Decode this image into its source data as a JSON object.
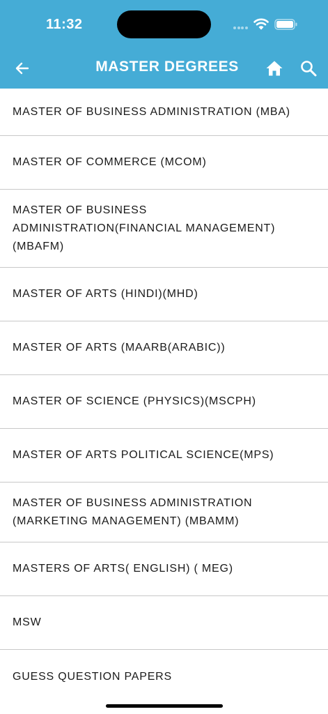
{
  "status_bar": {
    "time": "11:32"
  },
  "colors": {
    "header_background": "#45acd6",
    "header_foreground": "#ffffff",
    "list_text": "#1a1a1a",
    "divider": "#c8c8c8"
  },
  "toolbar": {
    "title": "MASTER DEGREES",
    "back_icon": "arrow-left-icon",
    "home_icon": "home-icon",
    "search_icon": "search-icon"
  },
  "degrees": [
    "MASTER OF BUSINESS ADMINISTRATION (MBA)",
    "MASTER OF COMMERCE (MCOM)",
    "MASTER OF BUSINESS ADMINISTRATION(FINANCIAL MANAGEMENT) (MBAFM)",
    "MASTER OF ARTS (HINDI)(MHD)",
    "MASTER OF ARTS (MAARB(ARABIC))",
    "MASTER OF SCIENCE (PHYSICS)(MSCPH)",
    "MASTER OF ARTS POLITICAL SCIENCE(MPS)",
    "MASTER OF BUSINESS ADMINISTRATION (MARKETING MANAGEMENT) (MBAMM)",
    "MASTERS OF ARTS( ENGLISH) ( MEG)",
    "MSW",
    "GUESS QUESTION PAPERS"
  ]
}
